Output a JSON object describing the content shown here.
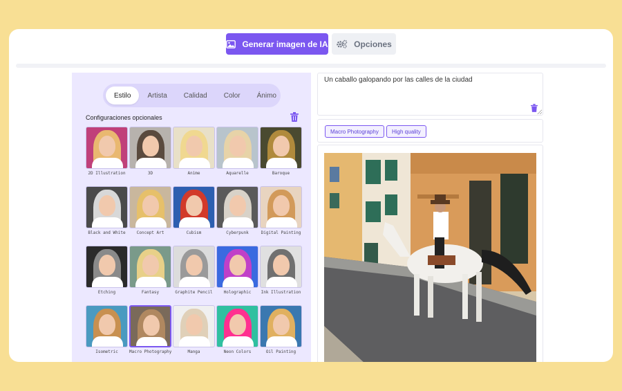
{
  "header": {
    "generate_label": "Generar imagen de IA",
    "options_label": "Opciones"
  },
  "style_tabs": [
    {
      "label": "Estilo",
      "active": true
    },
    {
      "label": "Artista",
      "active": false
    },
    {
      "label": "Calidad",
      "active": false
    },
    {
      "label": "Color",
      "active": false
    },
    {
      "label": "Ánimo",
      "active": false
    }
  ],
  "optional_settings_label": "Configuraciones opcionales",
  "styles": [
    {
      "label": "2D Illustration",
      "hair": "#e9b870",
      "bg": "#c0407a"
    },
    {
      "label": "3D",
      "hair": "#5a4a3e",
      "bg": "#b7b2ad"
    },
    {
      "label": "Anime",
      "hair": "#f0d890",
      "bg": "#e8e0c8"
    },
    {
      "label": "Aquarelle",
      "hair": "#e7d3a8",
      "bg": "#b8c4cc"
    },
    {
      "label": "Baroque",
      "hair": "#b08a3c",
      "bg": "#4a4a30"
    },
    {
      "label": "Black and White",
      "hair": "#d8d8d8",
      "bg": "#4a4a4a"
    },
    {
      "label": "Concept Art",
      "hair": "#e6c06a",
      "bg": "#c9b79d"
    },
    {
      "label": "Cubism",
      "hair": "#d23a2a",
      "bg": "#2d5fb0"
    },
    {
      "label": "Cyberpunk",
      "hair": "#d8d2c8",
      "bg": "#5a5a5a"
    },
    {
      "label": "Digital Painting",
      "hair": "#d29a5a",
      "bg": "#e8d4c0"
    },
    {
      "label": "Etching",
      "hair": "#8a8a8a",
      "bg": "#2a2a2a"
    },
    {
      "label": "Fantasy",
      "hair": "#e8d088",
      "bg": "#7a9a8a"
    },
    {
      "label": "Graphite Pencil",
      "hair": "#9a9a9a",
      "bg": "#dcdcdc"
    },
    {
      "label": "Holographic",
      "hair": "#c040c8",
      "bg": "#3a6ae0"
    },
    {
      "label": "Ink Illustration",
      "hair": "#707070",
      "bg": "#e0e0e0"
    },
    {
      "label": "Isometric",
      "hair": "#c89050",
      "bg": "#4a9ac0"
    },
    {
      "label": "Macro Photography",
      "hair": "#b08860",
      "bg": "#7a6a5a",
      "selected": true
    },
    {
      "label": "Manga",
      "hair": "#e0d0b8",
      "bg": "#f0f0f0"
    },
    {
      "label": "Neon Colors",
      "hair": "#ff3090",
      "bg": "#30c0a0"
    },
    {
      "label": "Oil Painting",
      "hair": "#e0b060",
      "bg": "#3a78b0"
    },
    {
      "label": "",
      "hair": "#e040a0",
      "bg": "#6a4ad0"
    },
    {
      "label": "",
      "hair": "#d03030",
      "bg": "#f0c020"
    },
    {
      "label": "",
      "hair": "#a08a70",
      "bg": "#c8c0b0"
    },
    {
      "label": "",
      "hair": "#e0b868",
      "bg": "#c04080"
    },
    {
      "label": "",
      "hair": "#e8e0c8",
      "bg": "#8a8080"
    }
  ],
  "prompt": {
    "value": "Un caballo galopando por las calles de la ciudad"
  },
  "selected_tags": [
    "Macro Photography",
    "High quality"
  ],
  "colors": {
    "accent": "#7b57f0",
    "background": "#f8df94",
    "panel": "#ece8ff"
  }
}
